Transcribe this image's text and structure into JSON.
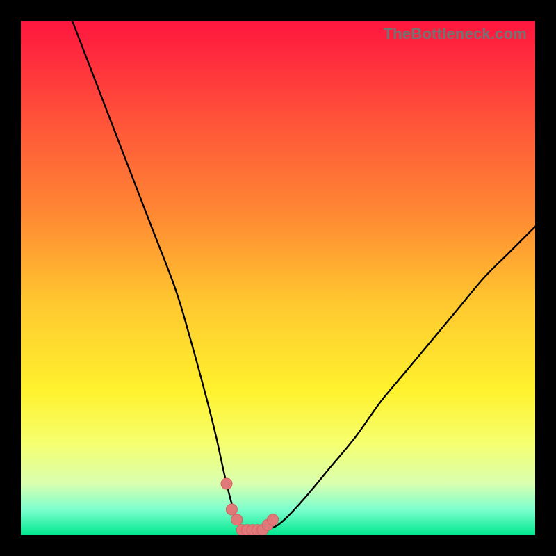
{
  "attribution": "TheBottleneck.com",
  "colors": {
    "page_bg": "#000000",
    "gradient_top": "#ff163f",
    "gradient_bottom": "#00e88f",
    "curve_stroke": "#000000",
    "marker_fill": "#e07a7a",
    "marker_stroke": "#d85f5f",
    "attribution_text": "#737373"
  },
  "chart_data": {
    "type": "line",
    "title": "",
    "xlabel": "",
    "ylabel": "",
    "xlim": [
      0,
      100
    ],
    "ylim": [
      0,
      100
    ],
    "grid": false,
    "legend": false,
    "series": [
      {
        "name": "bottleneck-curve",
        "x": [
          10,
          15,
          20,
          25,
          30,
          33,
          36,
          38,
          40,
          42,
          44,
          46,
          50,
          55,
          60,
          65,
          70,
          75,
          80,
          85,
          90,
          95,
          100
        ],
        "values": [
          100,
          87,
          74,
          61,
          48,
          38,
          27,
          19,
          10,
          3,
          1,
          1,
          2,
          7,
          13,
          19,
          26,
          32,
          38,
          44,
          50,
          55,
          60
        ]
      }
    ],
    "markers": {
      "name": "highlight-points",
      "x": [
        40,
        41,
        42,
        43,
        44,
        45,
        46,
        47,
        48,
        49
      ],
      "values": [
        10,
        5,
        3,
        1,
        1,
        1,
        1,
        1,
        2,
        3
      ]
    }
  }
}
